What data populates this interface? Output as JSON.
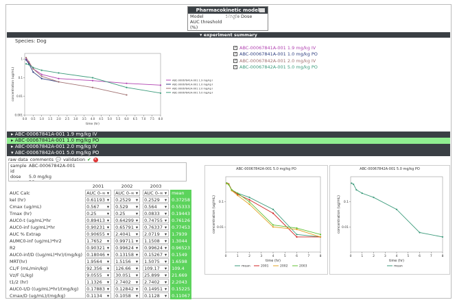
{
  "pk_options": {
    "title": "Pharmacokinetic model options",
    "rows": [
      {
        "label": "Model",
        "value": "Single Dose"
      },
      {
        "label": "AUC threshold (%)",
        "value": ""
      }
    ]
  },
  "summary_title": "experiment summary",
  "species": "Species: Dog",
  "legend_top": [
    {
      "label": "ABC-00067841A-001 1.9 mg/kg IV",
      "color": "#b040b0"
    },
    {
      "label": "ABC-00067841A-001 1.0 mg/kg PO",
      "color": "#304080"
    },
    {
      "label": "ABC-00067842A-001 2.0 mg/kg IV",
      "color": "#a07070"
    },
    {
      "label": "ABC-00067842A-001 5.0 mg/kg PO",
      "color": "#3a9a7a"
    }
  ],
  "groups": [
    {
      "label": "ABC-00067841A-001 1.9 mg/kg IV",
      "selected": false
    },
    {
      "label": "ABC-00067841A-001 1.0 mg/kg PO",
      "selected": true
    },
    {
      "label": "ABC-00067842A-001 2.0 mg/kg IV",
      "selected": false
    },
    {
      "label": "ABC-00067842A-001 5.0 mg/kg PO",
      "selected": false
    }
  ],
  "tabs": {
    "raw": "raw data",
    "comments": "comments",
    "validation": "validation"
  },
  "sample": [
    {
      "k": "sample id",
      "v": "ABC-00067842A-001"
    },
    {
      "k": "dose",
      "v": "5.0 mg/kg"
    },
    {
      "k": "route",
      "v": "PO"
    }
  ],
  "table": {
    "columns": [
      "2001",
      "2002",
      "2003"
    ],
    "auc_calc": {
      "label": "AUC Calc",
      "values": [
        "AUC 0-∞",
        "AUC 0-∞",
        "AUC 0-∞"
      ],
      "mean": "mean"
    },
    "rows": [
      {
        "label": "kel (hr)",
        "values": [
          "0.61193",
          "0.2529",
          "0.2529"
        ],
        "mean": "0.37258"
      },
      {
        "label": "Cmax (ug/mL)",
        "values": [
          "0.567",
          "0.529",
          "0.564"
        ],
        "mean": "0.55333"
      },
      {
        "label": "Tmax (hr)",
        "values": [
          "0.25",
          "0.25",
          "0.0833"
        ],
        "mean": "0.19443"
      },
      {
        "label": "AUC0-t (ug/mL)*hr",
        "values": [
          "0.89413",
          "0.64299",
          "0.74755"
        ],
        "mean": "0.76126"
      },
      {
        "label": "AUC0-inf (ug/mL)*hr",
        "values": [
          "0.90231",
          "0.65791",
          "0.76337"
        ],
        "mean": "0.77453"
      },
      {
        "label": "AUC % Extrap",
        "values": [
          "0.90655",
          "2.4041",
          "2.0719"
        ],
        "mean": "1.7939"
      },
      {
        "label": "AUMC0-inf (ug/mL)*hr2",
        "values": [
          "1.7652",
          "0.99711",
          "1.1508"
        ],
        "mean": "1.3044"
      },
      {
        "label": "R2",
        "values": [
          "0.90321",
          "0.99624",
          "0.99624"
        ],
        "mean": "0.96523"
      },
      {
        "label": "AUC0-inf/D ((ug/mL)*hr)/(mg/kg)",
        "values": [
          "0.18046",
          "0.13158",
          "0.15267"
        ],
        "mean": "0.1549"
      },
      {
        "label": "MRT(hr)",
        "values": [
          "1.9564",
          "1.5156",
          "1.5075"
        ],
        "mean": "1.6598"
      },
      {
        "label": "CL/F (mL/min/kg)",
        "values": [
          "92.356",
          "126.66",
          "109.17"
        ],
        "mean": "109.4"
      },
      {
        "label": "Vz/F (L/kg)",
        "values": [
          "9.0555",
          "30.051",
          "25.899"
        ],
        "mean": "21.669"
      },
      {
        "label": "t1/2 (hr)",
        "values": [
          "1.1326",
          "2.7402",
          "2.7402"
        ],
        "mean": "2.2043"
      },
      {
        "label": "AUC0-t/D ((ug/mL)*hr)/(mg/kg)",
        "values": [
          "0.17883",
          "0.12842",
          "0.14951"
        ],
        "mean": "0.15225"
      },
      {
        "label": "Cmax/D (ug/mL)/(mg/kg)",
        "values": [
          "0.1134",
          "0.1058",
          "0.1128"
        ],
        "mean": "0.11067"
      }
    ]
  },
  "chart_data": [
    {
      "type": "line",
      "title": "",
      "xlabel": "time (hr)",
      "ylabel": "concentration (ug/mL)",
      "yscale": "log",
      "xlim": [
        0,
        8
      ],
      "ylim": [
        0.001,
        2
      ],
      "xticks": [
        "0.0",
        "0.5",
        "1.0",
        "1.5",
        "2.0",
        "2.5",
        "3.0",
        "3.5",
        "4.0",
        "4.5",
        "5.0",
        "5.5",
        "6.0",
        "6.5",
        "7.0",
        "7.5",
        "8.0"
      ],
      "yticks": [
        "0.001",
        "0.01",
        "0.1",
        "1"
      ],
      "legend": "right",
      "series": [
        {
          "name": "ABC-00067841A-001 1.9 mg/kg IV",
          "color": "#b040b0",
          "x": [
            0.083,
            0.25,
            0.5,
            1,
            2,
            4,
            6,
            8
          ],
          "y": [
            1.0,
            0.6,
            0.3,
            0.15,
            0.09,
            0.07,
            0.05,
            0.04
          ]
        },
        {
          "name": "ABC-00067841A-001 1.0 mg/kg PO",
          "color": "#304080",
          "x": [
            0.083,
            0.25,
            0.5,
            1,
            2
          ],
          "y": [
            0.9,
            0.55,
            0.2,
            0.09,
            0.06
          ]
        },
        {
          "name": "ABC-00067842A-001 2.0 mg/kg IV",
          "color": "#a07070",
          "x": [
            0.083,
            0.25,
            0.5,
            1,
            2,
            4,
            6
          ],
          "y": [
            1.2,
            0.7,
            0.3,
            0.12,
            0.06,
            0.03,
            0.012
          ]
        },
        {
          "name": "ABC-00067842A-001 5.0 mg/kg PO",
          "color": "#3a9a7a",
          "x": [
            0.083,
            0.25,
            0.5,
            1,
            2,
            4,
            6,
            8
          ],
          "y": [
            0.55,
            0.5,
            0.35,
            0.25,
            0.18,
            0.1,
            0.03,
            0.015
          ]
        }
      ]
    },
    {
      "type": "line",
      "title": "ABC-00067842A-001 5.0 mg/kg PO",
      "xlabel": "time (hr)",
      "ylabel": "concentration (ug/mL)",
      "yscale": "log",
      "xlim": [
        0,
        8
      ],
      "ylim": [
        0.001,
        1
      ],
      "xticks": [
        "0",
        "1",
        "2",
        "3",
        "4",
        "5",
        "6",
        "7",
        "8"
      ],
      "yticks": [
        "0.01",
        "0.1"
      ],
      "legend": "bottom",
      "series": [
        {
          "name": "mean",
          "color": "#3a9a7a",
          "x": [
            0.083,
            0.25,
            0.5,
            1,
            2,
            4,
            6,
            8
          ],
          "y": [
            0.55,
            0.5,
            0.3,
            0.22,
            0.15,
            0.05,
            0.005,
            0.004
          ]
        },
        {
          "name": "2001",
          "color": "#d02020",
          "x": [
            0.083,
            0.25,
            0.5,
            1,
            2,
            4,
            6,
            8
          ],
          "y": [
            0.56,
            0.52,
            0.3,
            0.2,
            0.12,
            0.035,
            0.004,
            0.004
          ]
        },
        {
          "name": "2002",
          "color": "#e0a020",
          "x": [
            0.083,
            0.25,
            0.5,
            1,
            2,
            4,
            6,
            8
          ],
          "y": [
            0.53,
            0.5,
            0.28,
            0.18,
            0.08,
            0.01,
            0.008,
            0.004
          ]
        },
        {
          "name": "2003",
          "color": "#60c030",
          "x": [
            0.083,
            0.25,
            0.5,
            1,
            2,
            4,
            6,
            8
          ],
          "y": [
            0.56,
            0.48,
            0.3,
            0.22,
            0.1,
            0.012,
            0.009,
            0.005
          ]
        }
      ]
    },
    {
      "type": "line",
      "title": "ABC-00067842A-001 5.0 mg/kg PO",
      "xlabel": "time (hr)",
      "ylabel": "concentration (ug/mL)",
      "yscale": "log",
      "xlim": [
        0,
        8
      ],
      "ylim": [
        0.001,
        1
      ],
      "xticks": [
        "0",
        "1",
        "2",
        "3",
        "4",
        "5",
        "6",
        "7",
        "8"
      ],
      "yticks": [
        "0.01",
        "0.1"
      ],
      "legend": "bottom",
      "series": [
        {
          "name": "mean",
          "color": "#3a9a7a",
          "x": [
            0.083,
            0.25,
            0.5,
            1,
            2,
            4,
            6,
            8
          ],
          "y": [
            0.55,
            0.5,
            0.3,
            0.22,
            0.15,
            0.05,
            0.006,
            0.004
          ]
        }
      ]
    }
  ]
}
